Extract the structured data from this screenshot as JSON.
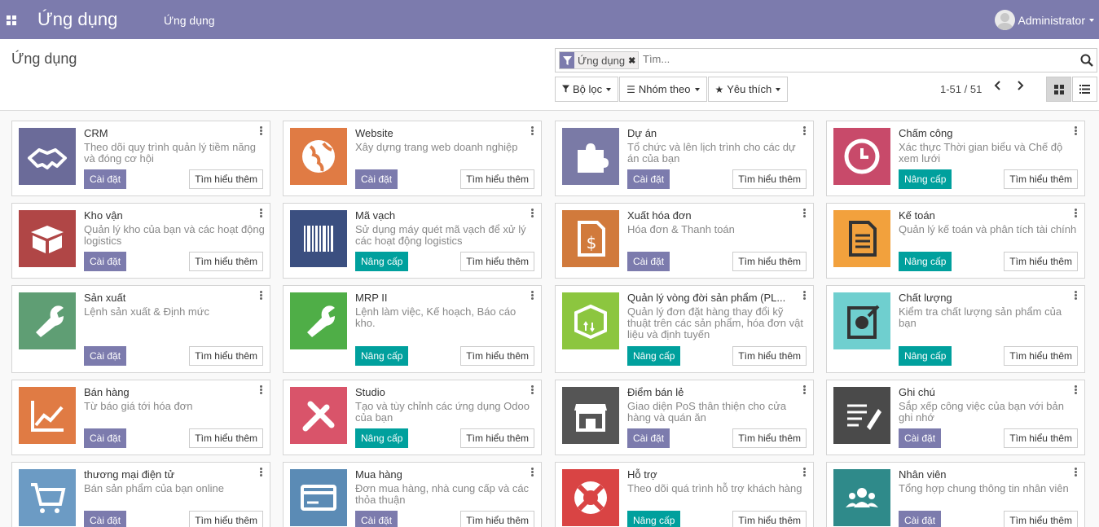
{
  "topbar": {
    "brand": "Ứng dụng",
    "menu": "Ứng dụng",
    "user": "Administrator"
  },
  "control_panel": {
    "title": "Ứng dụng",
    "facet": "Ứng dụng",
    "search_placeholder": "Tìm...",
    "filters": "Bộ lọc",
    "group_by": "Nhóm theo",
    "favorites": "Yêu thích",
    "pager": "1-51 / 51"
  },
  "labels": {
    "install": "Cài đặt",
    "upgrade": "Nâng cấp",
    "learn": "Tìm hiểu thêm"
  },
  "colors": {
    "topbar": "#7c7bad",
    "install": "#7c7bad",
    "upgrade": "#00a09d"
  },
  "apps": [
    {
      "name": "CRM",
      "summary": "Theo dõi quy trình quản lý tiềm năng và đóng cơ hội",
      "action": "Cài đặt",
      "icon": "handshake-icon",
      "color": "#6b6b99"
    },
    {
      "name": "Website",
      "summary": "Xây dựng trang web doanh nghiệp",
      "action": "Cài đặt",
      "icon": "globe-icon",
      "color": "#e07b44"
    },
    {
      "name": "Dự án",
      "summary": "Tổ chức và lên lịch trình cho các dự án của bạn",
      "action": "Cài đặt",
      "icon": "puzzle-icon",
      "color": "#7a7aa6"
    },
    {
      "name": "Chấm công",
      "summary": "Xác thực Thời gian biểu và Chế độ xem lưới",
      "action": "Nâng cấp",
      "icon": "clock-icon",
      "color": "#c84a6a"
    },
    {
      "name": "Kho vận",
      "summary": "Quản lý kho của bạn và các hoạt động logistics",
      "action": "Cài đặt",
      "icon": "box-icon",
      "color": "#b04646"
    },
    {
      "name": "Mã vạch",
      "summary": "Sử dụng máy quét mã vạch để xử lý các hoạt động logistics",
      "action": "Nâng cấp",
      "icon": "barcode-icon",
      "color": "#3b4f80"
    },
    {
      "name": "Xuất hóa đơn",
      "summary": "Hóa đơn & Thanh toán",
      "action": "Cài đặt",
      "icon": "invoice-icon",
      "color": "#d17a3c"
    },
    {
      "name": "Kế toán",
      "summary": "Quản lý kế toán và phân tích tài chính",
      "action": "Nâng cấp",
      "icon": "document-icon",
      "color": "#f2a13d"
    },
    {
      "name": "Sản xuất",
      "summary": "Lệnh sản xuất & Định mức",
      "action": "Cài đặt",
      "icon": "wrench-icon",
      "color": "#5f9e74"
    },
    {
      "name": "MRP II",
      "summary": "Lệnh làm việc, Kế hoạch, Báo cáo kho.",
      "action": "Nâng cấp",
      "icon": "wrench-icon",
      "color": "#4fae47"
    },
    {
      "name": "Quản lý vòng đời sản phẩm (PL...",
      "summary": "Quản lý đơn đặt hàng thay đổi kỹ thuật trên các sản phẩm, hóa đơn vật liệu và định tuyến",
      "action": "Nâng cấp",
      "icon": "package-icon",
      "color": "#8cc63f"
    },
    {
      "name": "Chất lượng",
      "summary": "Kiểm tra chất lượng sản phẩm của bạn",
      "action": "Nâng cấp",
      "icon": "quality-icon",
      "color": "#6fcfcf"
    },
    {
      "name": "Bán hàng",
      "summary": "Từ báo giá tới hóa đơn",
      "action": "Cài đặt",
      "icon": "chart-up-icon",
      "color": "#e07b44"
    },
    {
      "name": "Studio",
      "summary": "Tạo và tùy chỉnh các ứng dụng Odoo của bạn",
      "action": "Nâng cấp",
      "icon": "tools-icon",
      "color": "#d9546a"
    },
    {
      "name": "Điểm bán lẻ",
      "summary": "Giao diện PoS thân thiện cho cửa hàng và quán ăn",
      "action": "Cài đặt",
      "icon": "store-icon",
      "color": "#555555"
    },
    {
      "name": "Ghi chú",
      "summary": "Sắp xếp công việc của bạn với bản ghi nhớ",
      "action": "Cài đặt",
      "icon": "note-icon",
      "color": "#4a4a4a"
    },
    {
      "name": "thương mại điện tử",
      "summary": "Bán sản phẩm của bạn online",
      "action": "Cài đặt",
      "icon": "cart-icon",
      "color": "#6c9bc4"
    },
    {
      "name": "Mua hàng",
      "summary": "Đơn mua hàng, nhà cung cấp và các thỏa thuận",
      "action": "Cài đặt",
      "icon": "card-icon",
      "color": "#5b8bb5"
    },
    {
      "name": "Hỗ trợ",
      "summary": "Theo dõi quá trình hỗ trợ khách hàng",
      "action": "Nâng cấp",
      "icon": "lifebuoy-icon",
      "color": "#d94444"
    },
    {
      "name": "Nhân viên",
      "summary": "Tổng hợp chung thông tin nhân viên",
      "action": "Cài đặt",
      "icon": "people-icon",
      "color": "#2f8a8a"
    }
  ]
}
